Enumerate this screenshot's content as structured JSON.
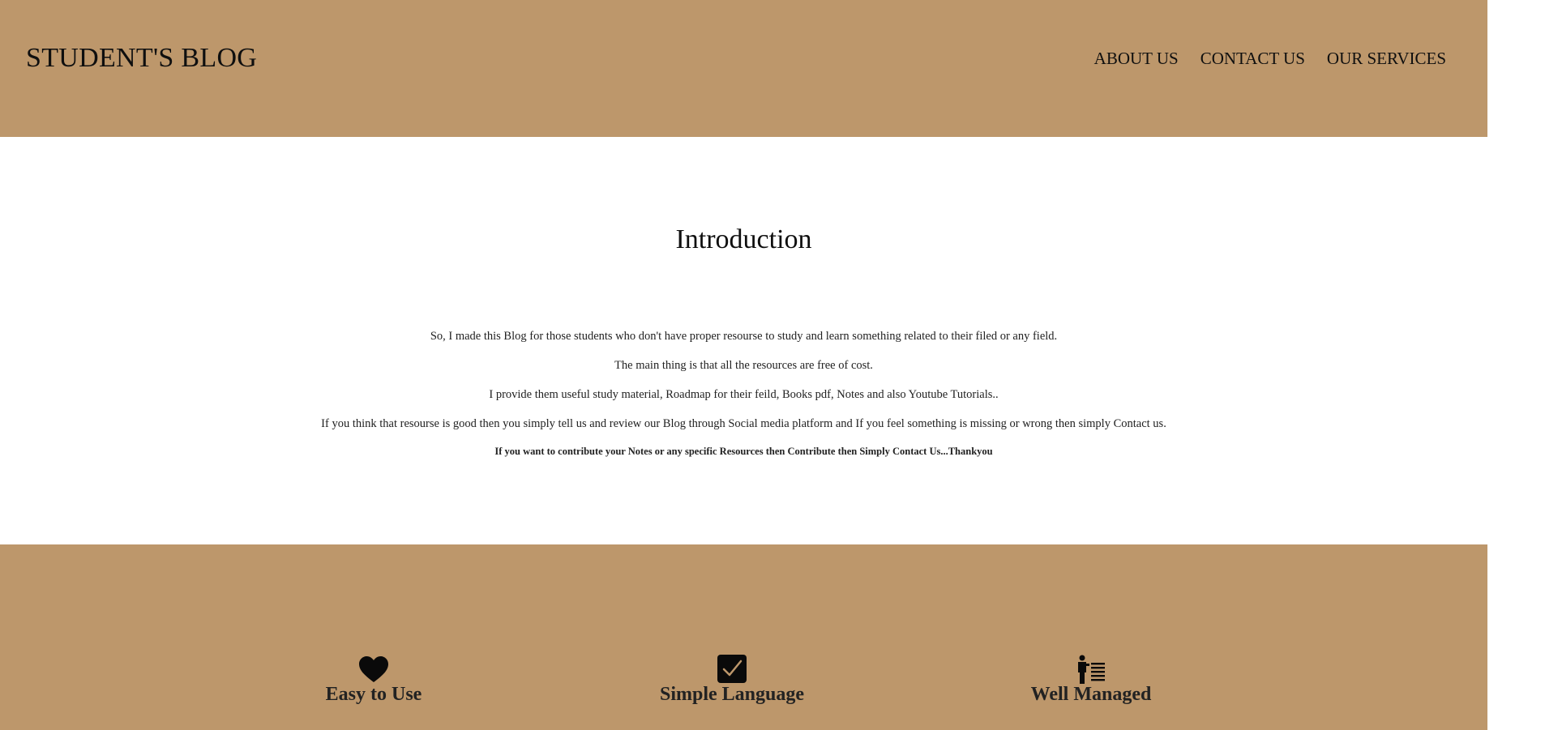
{
  "header": {
    "brand": "STUDENT'S BLOG",
    "nav": [
      {
        "label": "ABOUT US"
      },
      {
        "label": "CONTACT US"
      },
      {
        "label": "OUR SERVICES"
      }
    ]
  },
  "intro": {
    "title": "Introduction",
    "paragraphs": [
      "So, I made this Blog for those students who don't have proper resourse to study and learn something related to their filed or any field.",
      "The main thing is that all the resources are free of cost.",
      "I provide them useful study material, Roadmap for their feild, Books pdf, Notes and also Youtube Tutorials..",
      "If you think that resourse is good then you simply tell us and review our Blog through Social media platform and If you feel something is missing or wrong then simply Contact us."
    ],
    "note": "If you want to contribute your Notes or any specific Resources then Contribute then Simply Contact Us...Thankyou"
  },
  "features": [
    {
      "icon": "heart-icon",
      "label": "Easy to Use"
    },
    {
      "icon": "checkbox-icon",
      "label": "Simple Language"
    },
    {
      "icon": "person-list-icon",
      "label": "Well Managed"
    }
  ],
  "colors": {
    "band": "#bd976b",
    "background": "#ffffff",
    "text": "#111111"
  }
}
